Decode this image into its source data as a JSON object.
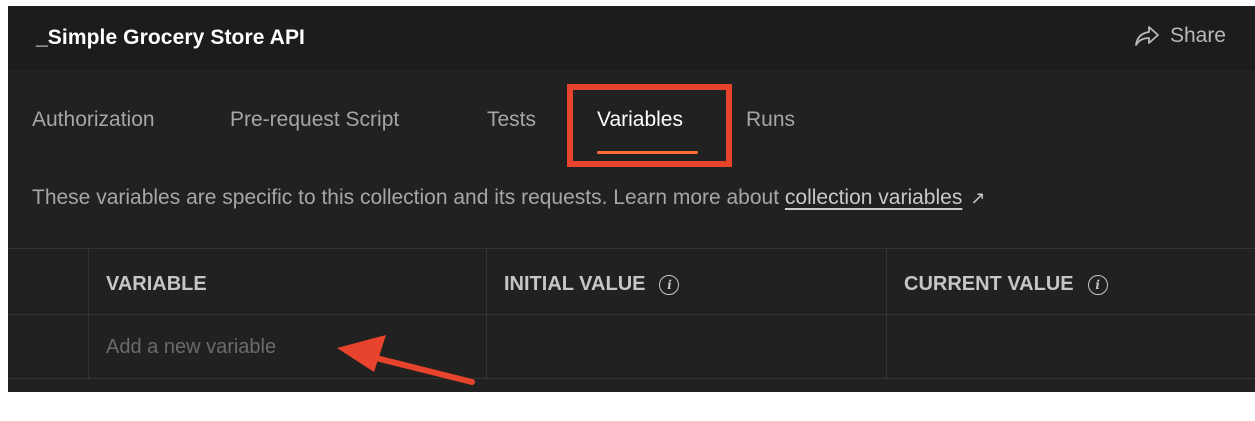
{
  "header": {
    "title": "_Simple Grocery Store API",
    "share_label": "Share",
    "share_icon": "share-arrow-icon"
  },
  "tabs": [
    {
      "label": "Authorization",
      "active": false
    },
    {
      "label": "Pre-request Script",
      "active": false
    },
    {
      "label": "Tests",
      "active": false
    },
    {
      "label": "Variables",
      "active": true
    },
    {
      "label": "Runs",
      "active": false
    }
  ],
  "info": {
    "text": "These variables are specific to this collection and its requests. Learn more about ",
    "link": "collection variables",
    "link_icon": "external-arrow-icon"
  },
  "table": {
    "columns": [
      "VARIABLE",
      "INITIAL VALUE",
      "CURRENT VALUE"
    ],
    "column_info_icon": "info-circle-icon",
    "new_variable_placeholder": "Add a new variable"
  },
  "colors": {
    "panel_bg": "#212121",
    "header_bg": "#1c1c1c",
    "accent_underline": "#ff6c37",
    "annotation_red": "#e8432c"
  }
}
